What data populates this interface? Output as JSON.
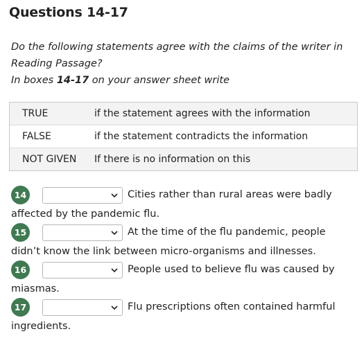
{
  "heading": "Questions 14-17",
  "instructions": {
    "line1": "Do the following statements agree with the claims of the writer in",
    "line2": "Reading Passage?",
    "line3_prefix": "In boxes ",
    "line3_boxes": "14-17",
    "line3_suffix": " on your answer sheet write"
  },
  "legend": [
    {
      "key": "TRUE",
      "desc": "if the statement agrees with the information"
    },
    {
      "key": "FALSE",
      "desc": "if the statement contradicts the information"
    },
    {
      "key": "NOT GIVEN",
      "desc": "If there is no information on this"
    }
  ],
  "questions": [
    {
      "number": "14",
      "selected": "",
      "text": "Cities rather than rural areas were badly affected by the pandemic flu."
    },
    {
      "number": "15",
      "selected": "",
      "text": "At the time of the flu pandemic, people didn’t know the link between micro-organisms and illnesses."
    },
    {
      "number": "16",
      "selected": "",
      "text": "People used to believe flu was caused by miasmas."
    },
    {
      "number": "17",
      "selected": "",
      "text": "Flu prescriptions often contained harmful ingredients."
    }
  ],
  "colors": {
    "badge": "#3f7a51",
    "legend_border": "#c9c9c9",
    "legend_shade": "#f3f3f3"
  },
  "icons": {
    "dropdown": "chevron-down-icon"
  }
}
